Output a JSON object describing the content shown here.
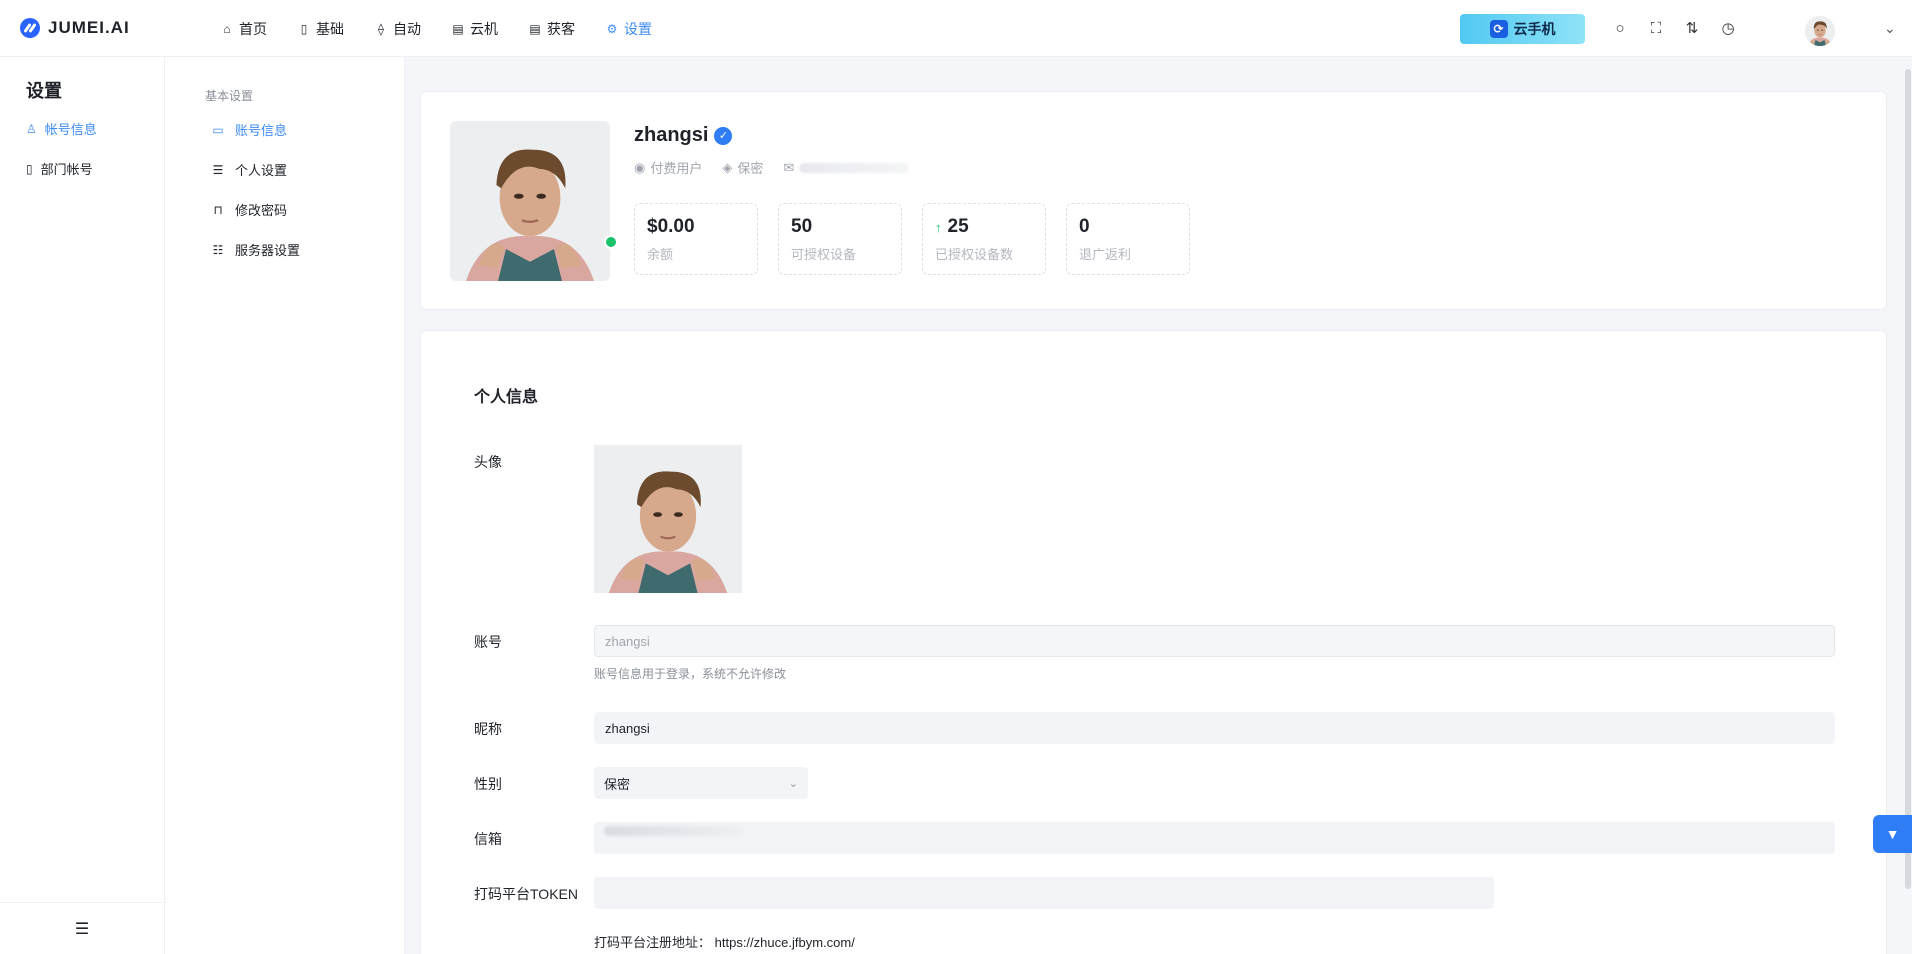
{
  "brand": {
    "name": "JUMEI.AI"
  },
  "nav": [
    {
      "label": "首页",
      "icon": "home-icon",
      "glyph": "⌂"
    },
    {
      "label": "基础",
      "icon": "phone-icon",
      "glyph": "▯"
    },
    {
      "label": "自动",
      "icon": "nodes-icon",
      "glyph": "⟠"
    },
    {
      "label": "云机",
      "icon": "doc-icon",
      "glyph": "▤"
    },
    {
      "label": "获客",
      "icon": "doc-icon",
      "glyph": "▤"
    },
    {
      "label": "设置",
      "icon": "gear-icon",
      "glyph": "⚙"
    }
  ],
  "header": {
    "cloud_button": "云手机"
  },
  "sidebar": {
    "title": "设置",
    "items": [
      {
        "label": "帐号信息",
        "glyph": "👤"
      },
      {
        "label": "部门帐号",
        "glyph": "▯"
      }
    ]
  },
  "submenu": {
    "group": "基本设置",
    "items": [
      {
        "label": "账号信息",
        "glyph": "▭"
      },
      {
        "label": "个人设置",
        "glyph": "☰"
      },
      {
        "label": "修改密码",
        "glyph": "🔒"
      },
      {
        "label": "服务器设置",
        "glyph": "☷"
      }
    ]
  },
  "profile": {
    "username": "zhangsi",
    "role": "付费用户",
    "gender": "保密",
    "stats": [
      {
        "value": "$0.00",
        "label": "余额"
      },
      {
        "value": "50",
        "label": "可授权设备"
      },
      {
        "value": "25",
        "label": "已授权设备数"
      },
      {
        "value": "0",
        "label": "退广返利"
      }
    ]
  },
  "form": {
    "title": "个人信息",
    "avatar_label": "头像",
    "account_label": "账号",
    "account_value": "zhangsi",
    "account_hint": "账号信息用于登录，系统不允许修改",
    "nickname_label": "昵称",
    "nickname_value": "zhangsi",
    "gender_label": "性别",
    "gender_value": "保密",
    "email_label": "信箱",
    "token_label": "打码平台TOKEN",
    "token_value": "",
    "reg_label": "打码平台注册地址：",
    "reg_url": "https://zhuce.jfbym.com/"
  }
}
